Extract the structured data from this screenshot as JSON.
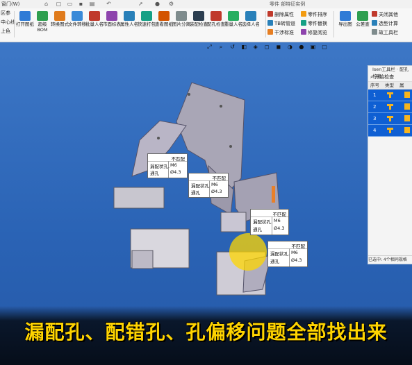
{
  "topbar": {
    "tab": "窗门(W)",
    "doc_title": "零件 部特征实例"
  },
  "ribbon": {
    "left_items": [
      "区参",
      "中心线",
      "上色"
    ],
    "buttons": [
      {
        "label": "打开图纸",
        "color": "#2f7bd6"
      },
      {
        "label": "超级BOM",
        "color": "#2e9e4f"
      },
      {
        "label": "转换图式",
        "color": "#e07b1c"
      },
      {
        "label": "文件转移",
        "color": "#3a8ad8"
      },
      {
        "label": "批量人名",
        "color": "#c0392b"
      },
      {
        "label": "市面标表",
        "color": "#8e44ad"
      },
      {
        "label": "属性人名",
        "color": "#2980b9"
      },
      {
        "label": "快速打包",
        "color": "#16a085"
      },
      {
        "label": "查看图纸",
        "color": "#d35400"
      },
      {
        "label": "图片分离",
        "color": "#7f8c8d"
      },
      {
        "label": "装配检查",
        "color": "#2c3e50"
      },
      {
        "label": "配孔检查",
        "color": "#c0392b"
      },
      {
        "label": "重量人名",
        "color": "#27ae60"
      },
      {
        "label": "选择人名",
        "color": "#2980b9"
      }
    ],
    "small_items": [
      {
        "label": "删除属性",
        "color": "#c0392b"
      },
      {
        "label": "TB转管道",
        "color": "#2980b9"
      },
      {
        "label": "干涉标准",
        "color": "#e67e22"
      },
      {
        "label": "零件排序",
        "color": "#f39c12"
      },
      {
        "label": "零件替换",
        "color": "#16a085"
      },
      {
        "label": "修复阅览",
        "color": "#8e44ad"
      }
    ],
    "right_buttons": [
      {
        "label": "导出图",
        "color": "#2f7bd6"
      },
      {
        "label": "公差查",
        "color": "#2e9e4f"
      }
    ],
    "right_small": [
      {
        "label": "关闭其他",
        "color": "#c0392b"
      },
      {
        "label": "选型计算",
        "color": "#2980b9"
      },
      {
        "label": "故工具栏",
        "color": "#7f8c8d"
      }
    ]
  },
  "panel": {
    "title": "Isen工具栏 · 配孔检查",
    "tool_label": "开始检查",
    "columns": [
      "序号",
      "类型",
      "属"
    ],
    "rows": [
      "1",
      "2",
      "3",
      "4"
    ],
    "status": "已选中: 4个相同规格"
  },
  "callouts": [
    {
      "status": "不匹配",
      "row1_label": "漏配状孔.",
      "row1_value": "M6",
      "row2_label": "通孔",
      "row2_value": "Ø4.3"
    },
    {
      "status": "不匹配",
      "row1_label": "漏配状孔.",
      "row1_value": "M6",
      "row2_label": "通孔",
      "row2_value": "Ø4.3"
    },
    {
      "status": "不匹配",
      "row1_label": "漏配状孔.",
      "row1_value": "M6",
      "row2_label": "通孔",
      "row2_value": "Ø4.3"
    },
    {
      "status": "不匹配",
      "row1_label": "漏配状孔.",
      "row1_value": "M6",
      "row2_label": "通孔",
      "row2_value": "Ø4.3"
    }
  ],
  "caption": "漏配孔、配错孔、孔偏移问题全部找出来",
  "colors": {
    "viewport": "#2f68b8",
    "highlight": "#ffd700",
    "caption": "#ffd400",
    "part_plate": "#a9a6b6"
  }
}
